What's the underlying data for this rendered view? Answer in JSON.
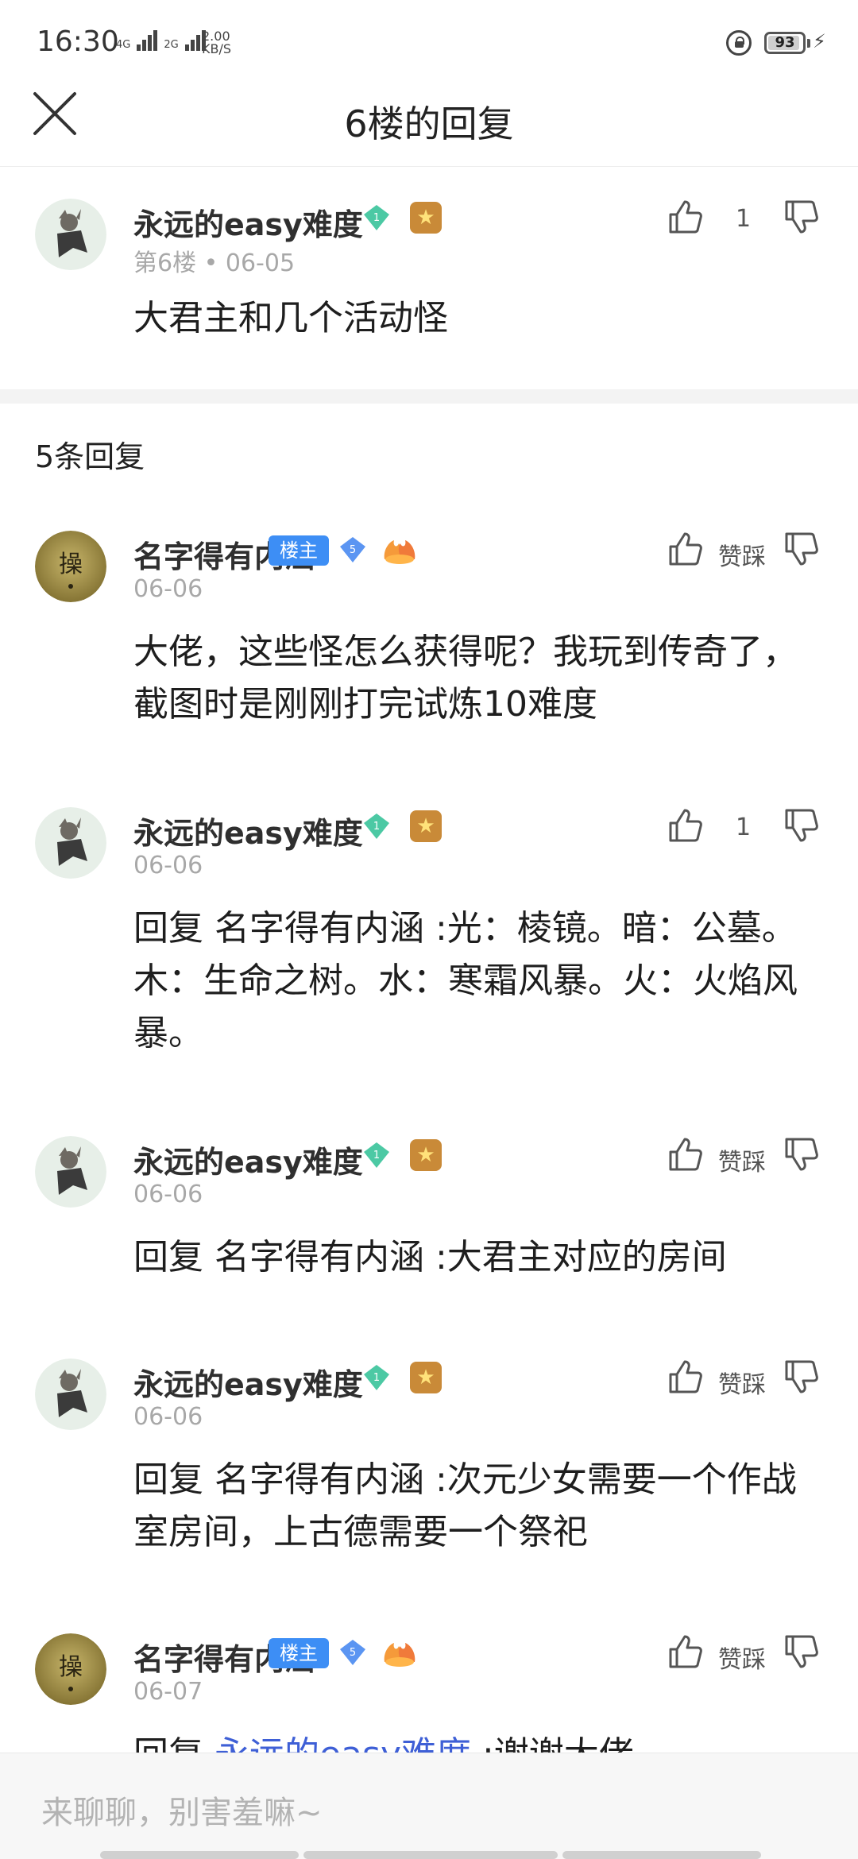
{
  "status_bar": {
    "time": "16:30",
    "net1": "4G",
    "net2": "2G",
    "speed_value": "2.00",
    "speed_unit": "KB/S",
    "battery": "93"
  },
  "header": {
    "title": "6楼的回复"
  },
  "main_post": {
    "user": "永远的easy难度",
    "level": "1",
    "floor": "第6楼",
    "date": "06-05",
    "likes": "1",
    "content": "大君主和几个活动怪"
  },
  "replies_header": "5条回复",
  "owner_tag": "楼主",
  "like_label": "赞踩",
  "replies": [
    {
      "user": "名字得有内涵",
      "avatar_char": "操",
      "level": "5",
      "is_owner": true,
      "date": "06-06",
      "likes": "",
      "content": "大佬，这些怪怎么获得呢？我玩到传奇了，截图时是刚刚打完试炼10难度"
    },
    {
      "user": "永远的easy难度",
      "level": "1",
      "is_owner": false,
      "date": "06-06",
      "likes": "1",
      "content": "回复 名字得有内涵 :光：棱镜。暗：公墓。木：生命之树。水：寒霜风暴。火：火焰风暴。"
    },
    {
      "user": "永远的easy难度",
      "level": "1",
      "is_owner": false,
      "date": "06-06",
      "likes": "",
      "content": "回复 名字得有内涵 :大君主对应的房间"
    },
    {
      "user": "永远的easy难度",
      "level": "1",
      "is_owner": false,
      "date": "06-06",
      "likes": "",
      "content": "回复 名字得有内涵 :次元少女需要一个作战室房间，上古德需要一个祭祀"
    },
    {
      "user": "名字得有内涵",
      "avatar_char": "操",
      "level": "5",
      "is_owner": true,
      "date": "06-07",
      "likes": "",
      "content_prefix": "回复 ",
      "content_link": "永远的easy难度",
      "content_suffix": " :谢谢大佬"
    }
  ],
  "input": {
    "placeholder": "来聊聊，别害羞嘛~"
  },
  "colors": {
    "accent": "#3d8ef5",
    "link": "#3e5fd6",
    "meta": "#a8a8a8"
  }
}
